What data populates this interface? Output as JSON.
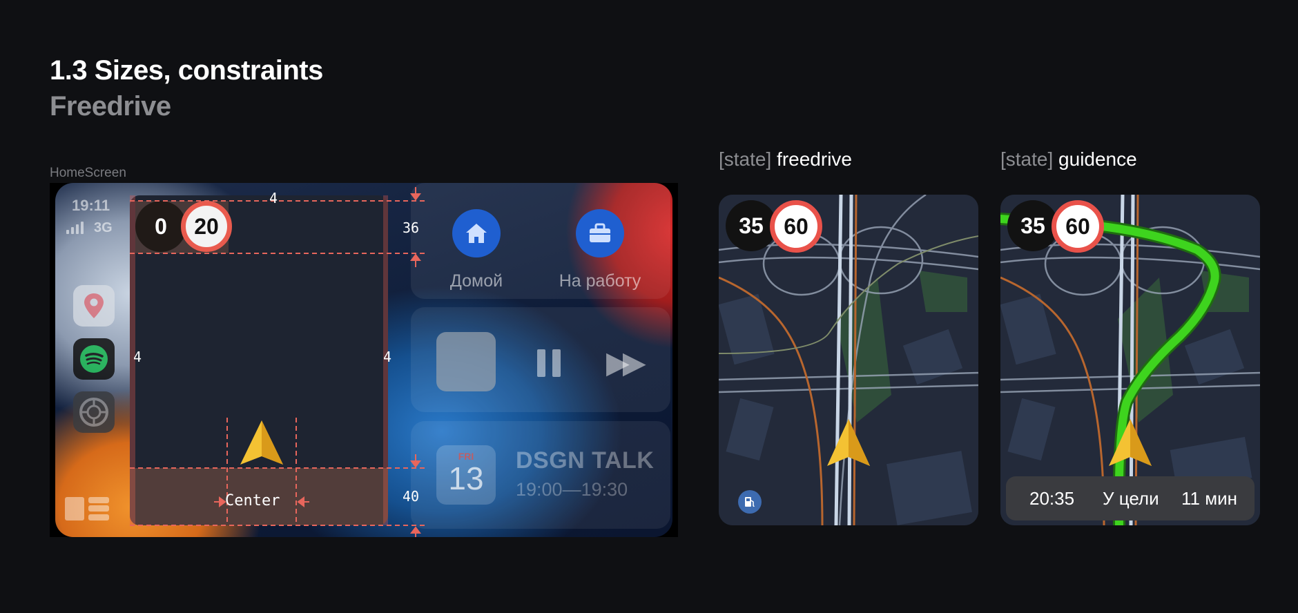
{
  "header": {
    "title": "1.3 Sizes, constraints",
    "subtitle": "Freedrive"
  },
  "homescreen": {
    "section_label": "HomeScreen",
    "status": {
      "time": "19:11",
      "network": "3G"
    },
    "dock": {
      "apps": [
        "maps-app-icon",
        "spotify-app-icon",
        "settings-app-icon"
      ],
      "grid_icon": "dashboard-grid-icon"
    },
    "destinations": [
      {
        "label": "Домой",
        "icon": "home-icon"
      },
      {
        "label": "На работу",
        "icon": "briefcase-icon"
      }
    ],
    "media": {
      "pause_icon": "pause-icon",
      "next_icon": "fast-forward-icon"
    },
    "calendar": {
      "day": "FRI",
      "date": "13",
      "title": "DSGN TALK",
      "time": "19:00—19:30"
    },
    "map_widget": {
      "speed_current": "0",
      "speed_limit": "20",
      "center_label": "Center",
      "dims": {
        "top": "4",
        "left": "4",
        "right": "4",
        "top_zone": "36",
        "bottom_zone": "40"
      }
    }
  },
  "states": {
    "freedrive": {
      "prefix": "[state]",
      "name": "freedrive",
      "speed_current": "35",
      "speed_limit": "60",
      "fuel_icon": "fuel-station-icon"
    },
    "guidance": {
      "prefix": "[state]",
      "name": "guidence",
      "speed_current": "35",
      "speed_limit": "60",
      "eta": {
        "time": "20:35",
        "destination": "У цели",
        "duration": "11 мин"
      }
    }
  },
  "colors": {
    "background": "#0f1013",
    "guide_red": "#e8665c",
    "speed_limit_ring": "#e9524a",
    "route_green": "#3ed41e",
    "cursor_yellow": "#f4c233"
  }
}
